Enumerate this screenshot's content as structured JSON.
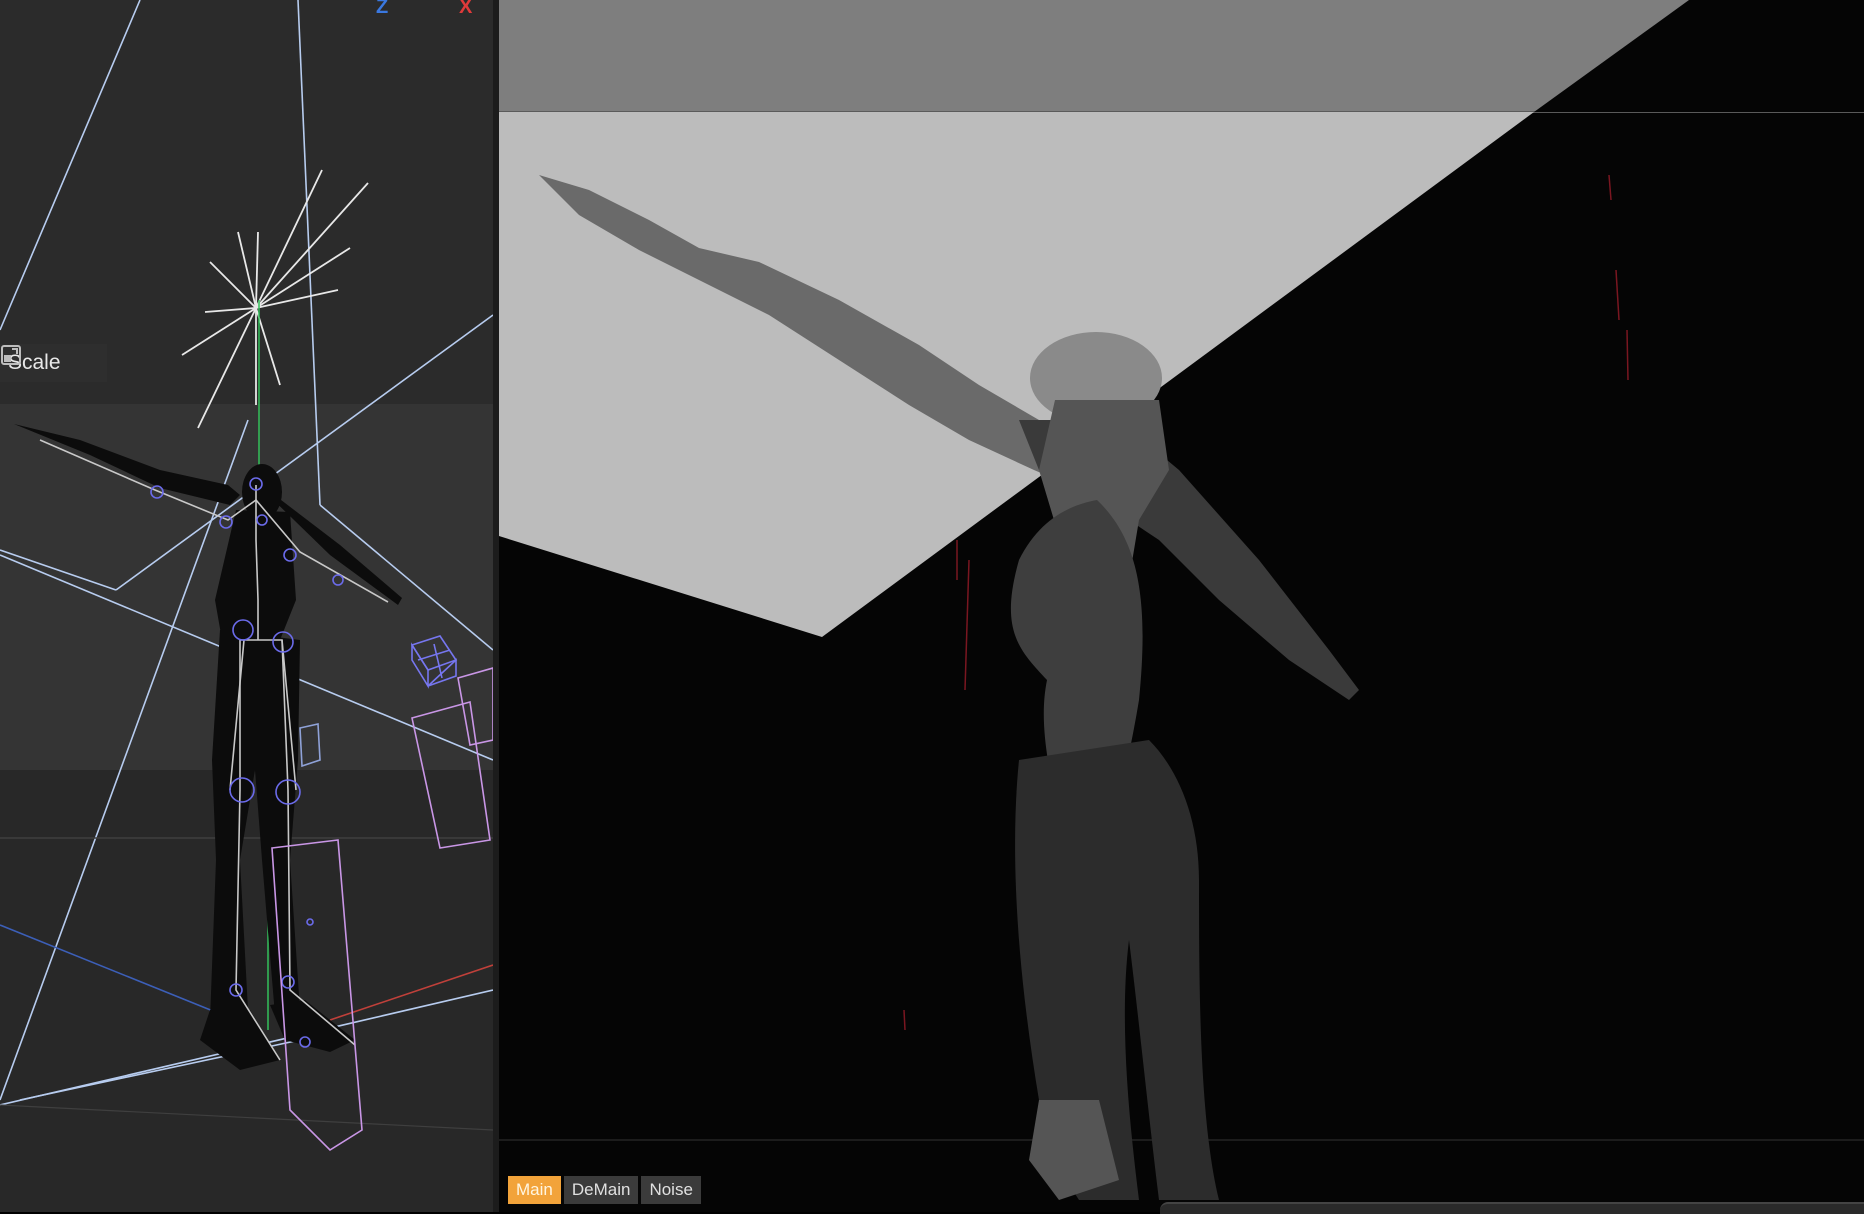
{
  "left_viewport": {
    "axis_z_label": "Z",
    "axis_x_label": "X",
    "scale_tool_label": "Scale"
  },
  "render_view": {
    "tabs": [
      {
        "label": "Main",
        "active": true
      },
      {
        "label": "DeMain",
        "active": false
      },
      {
        "label": "Noise",
        "active": false
      }
    ]
  },
  "colors": {
    "accent_tab": "#f2a33a",
    "axis_z": "#3a78e0",
    "axis_x": "#e03a3a"
  }
}
